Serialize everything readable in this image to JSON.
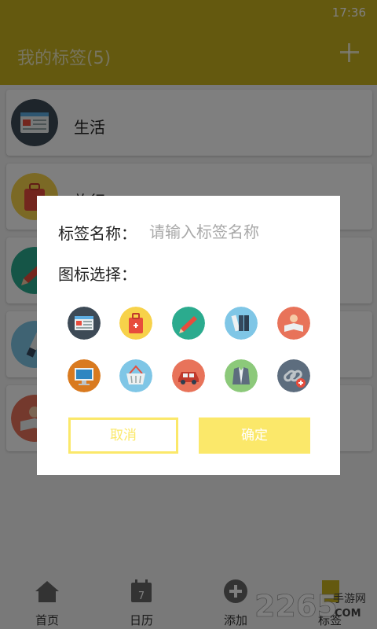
{
  "status_bar": {
    "time": "17:36"
  },
  "app_bar": {
    "title": "我的标签(5)"
  },
  "tags": [
    {
      "label": "生活",
      "icon": "browser-window-icon"
    },
    {
      "label": "旅行",
      "icon": "suitcase-icon"
    },
    {
      "label": "",
      "icon": "pencil-icon"
    },
    {
      "label": "",
      "icon": "usb-drive-icon"
    },
    {
      "label": "",
      "icon": "reading-person-icon"
    }
  ],
  "dialog": {
    "name_label": "标签名称：",
    "name_placeholder": "请输入标签名称",
    "name_value": "",
    "icon_select_label": "图标选择：",
    "icons": [
      "browser-window-icon",
      "suitcase-icon",
      "pencil-icon",
      "binders-icon",
      "reading-person-icon",
      "monitor-icon",
      "shopping-basket-icon",
      "car-icon",
      "jacket-icon",
      "link-add-icon"
    ],
    "cancel_label": "取消",
    "confirm_label": "确定"
  },
  "bottom_nav": [
    {
      "label": "首页",
      "icon": "home-icon"
    },
    {
      "label": "日历",
      "icon": "calendar-icon"
    },
    {
      "label": "添加",
      "icon": "add-circle-icon"
    },
    {
      "label": "标签",
      "icon": "tag-icon"
    }
  ],
  "calendar_day": "7",
  "watermark": {
    "number": "2265",
    "site": "手游网",
    "suffix": "COM"
  },
  "colors": {
    "primary": "#c9b21f",
    "accent": "#fbe86a",
    "overlay": "rgba(0,0,0,0.5)"
  }
}
